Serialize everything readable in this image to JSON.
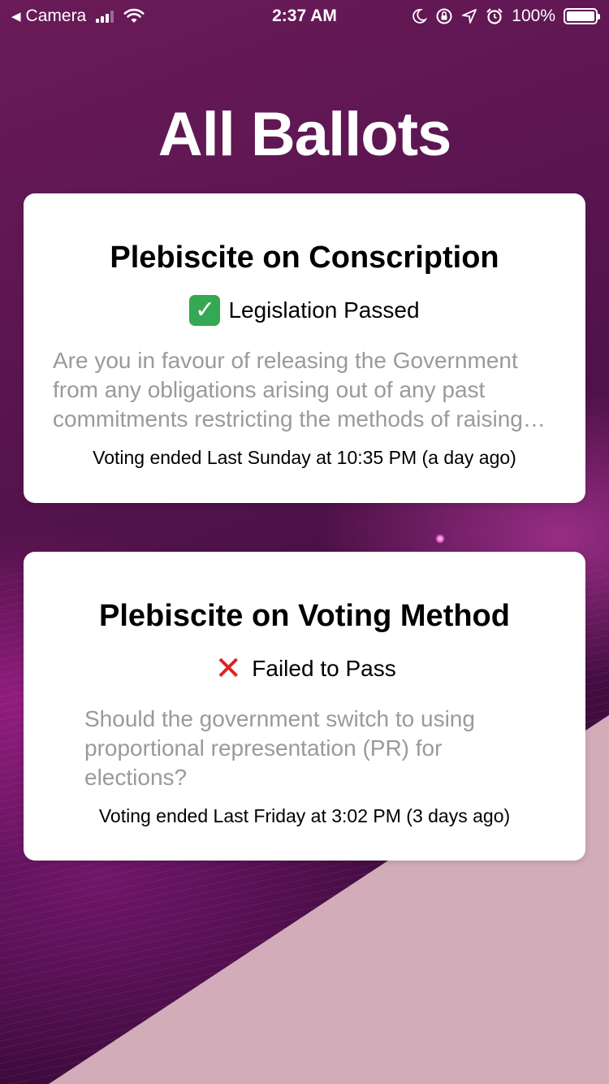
{
  "status_bar": {
    "back_label": "Camera",
    "time": "2:37 AM",
    "battery": "100%"
  },
  "page": {
    "title": "All Ballots"
  },
  "ballots": [
    {
      "title": "Plebiscite on Conscription",
      "status_icon": "check-icon",
      "status": "Legislation Passed",
      "description": "Are you in favour of releasing the Government from any obligations arising out of any past commitments restricting the methods of raising men for military service?",
      "voting_ended": "Voting ended Last Sunday at 10:35 PM (a day ago)"
    },
    {
      "title": "Plebiscite on Voting Method",
      "status_icon": "cross-icon",
      "status": "Failed to Pass",
      "description": "Should the government switch to using proportional representation (PR) for elections?",
      "voting_ended": "Voting ended Last Friday at 3:02 PM (3 days ago)"
    }
  ],
  "colors": {
    "background_top": "#6a1b58",
    "background_bottom": "#2b072e",
    "corner_accent": "#d3acba",
    "card_background": "#ffffff",
    "description_text": "#9a9a9a",
    "passed_icon": "#34a853",
    "failed_icon": "#e02020"
  }
}
